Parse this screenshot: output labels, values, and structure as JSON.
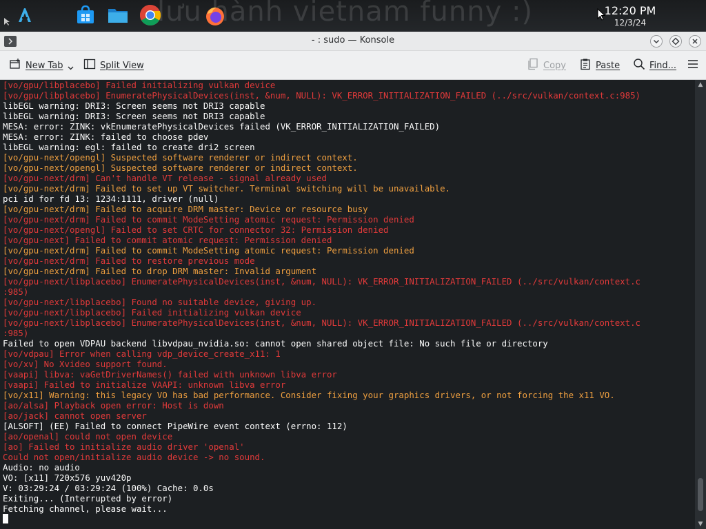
{
  "taskbar": {
    "wallpaper_text": "lưu hành vietnam funny :)",
    "time": "12:20 PM",
    "date": "12/3/24",
    "apps": [
      "app-launcher-icon",
      "discover-store-icon",
      "file-manager-icon",
      "chrome-icon",
      "firefox-icon"
    ]
  },
  "window": {
    "title": "- : sudo — Konsole"
  },
  "toolbar": {
    "new_tab": "New Tab",
    "split_view": "Split View",
    "copy": "Copy",
    "paste": "Paste",
    "find": "Find..."
  },
  "colors": {
    "terminal_bg": "#1c1f22",
    "text_white": "#fcfcfc",
    "text_red": "#e23a3a",
    "text_orange": "#f0a040"
  },
  "terminal": {
    "lines": [
      {
        "text": "[vo/gpu/libplacebo] Failed initializing vulkan device",
        "color": "red"
      },
      {
        "text": "[vo/gpu/libplacebo] EnumeratePhysicalDevices(inst, &num, NULL): VK_ERROR_INITIALIZATION_FAILED (../src/vulkan/context.c:985)",
        "color": "red"
      },
      {
        "text": "libEGL warning: DRI3: Screen seems not DRI3 capable",
        "color": "white"
      },
      {
        "text": "libEGL warning: DRI3: Screen seems not DRI3 capable",
        "color": "white"
      },
      {
        "text": "MESA: error: ZINK: vkEnumeratePhysicalDevices failed (VK_ERROR_INITIALIZATION_FAILED)",
        "color": "white"
      },
      {
        "text": "MESA: error: ZINK: failed to choose pdev",
        "color": "white"
      },
      {
        "text": "libEGL warning: egl: failed to create dri2 screen",
        "color": "white"
      },
      {
        "text": "[vo/gpu-next/opengl] Suspected software renderer or indirect context.",
        "color": "orange"
      },
      {
        "text": "[vo/gpu-next/opengl] Suspected software renderer or indirect context.",
        "color": "orange"
      },
      {
        "text": "[vo/gpu-next/drm] Can't handle VT release - signal already used",
        "color": "red"
      },
      {
        "text": "[vo/gpu-next/drm] Failed to set up VT switcher. Terminal switching will be unavailable.",
        "color": "orange"
      },
      {
        "text": "pci id for fd 13: 1234:1111, driver (null)",
        "color": "white"
      },
      {
        "text": "[vo/gpu-next/drm] Failed to acquire DRM master: Device or resource busy",
        "color": "orange"
      },
      {
        "text": "[vo/gpu-next/drm] Failed to commit ModeSetting atomic request: Permission denied",
        "color": "red"
      },
      {
        "text": "[vo/gpu-next/opengl] Failed to set CRTC for connector 32: Permission denied",
        "color": "red"
      },
      {
        "text": "[vo/gpu-next] Failed to commit atomic request: Permission denied",
        "color": "red"
      },
      {
        "text": "[vo/gpu-next/drm] Failed to commit ModeSetting atomic request: Permission denied",
        "color": "orange"
      },
      {
        "text": "[vo/gpu-next/drm] Failed to restore previous mode",
        "color": "red"
      },
      {
        "text": "[vo/gpu-next/drm] Failed to drop DRM master: Invalid argument",
        "color": "orange"
      },
      {
        "text": "[vo/gpu-next/libplacebo] EnumeratePhysicalDevices(inst, &num, NULL): VK_ERROR_INITIALIZATION_FAILED (../src/vulkan/context.c",
        "color": "red"
      },
      {
        "text": ":985)",
        "color": "red"
      },
      {
        "text": "[vo/gpu-next/libplacebo] Found no suitable device, giving up.",
        "color": "red"
      },
      {
        "text": "[vo/gpu-next/libplacebo] Failed initializing vulkan device",
        "color": "red"
      },
      {
        "text": "[vo/gpu-next/libplacebo] EnumeratePhysicalDevices(inst, &num, NULL): VK_ERROR_INITIALIZATION_FAILED (../src/vulkan/context.c",
        "color": "red"
      },
      {
        "text": ":985)",
        "color": "red"
      },
      {
        "text": "Failed to open VDPAU backend libvdpau_nvidia.so: cannot open shared object file: No such file or directory",
        "color": "white"
      },
      {
        "text": "[vo/vdpau] Error when calling vdp_device_create_x11: 1",
        "color": "red"
      },
      {
        "text": "[vo/xv] No Xvideo support found.",
        "color": "red"
      },
      {
        "text": "[vaapi] libva: vaGetDriverNames() failed with unknown libva error",
        "color": "red"
      },
      {
        "text": "[vaapi] Failed to initialize VAAPI: unknown libva error",
        "color": "red"
      },
      {
        "text": "[vo/x11] Warning: this legacy VO has bad performance. Consider fixing your graphics drivers, or not forcing the x11 VO.",
        "color": "orange"
      },
      {
        "text": "[ao/alsa] Playback open error: Host is down",
        "color": "red"
      },
      {
        "text": "[ao/jack] cannot open server",
        "color": "red"
      },
      {
        "text": "[ALSOFT] (EE) Failed to connect PipeWire event context (errno: 112)",
        "color": "white"
      },
      {
        "text": "[ao/openal] could not open device",
        "color": "red"
      },
      {
        "text": "[ao] Failed to initialize audio driver 'openal'",
        "color": "red"
      },
      {
        "text": "Could not open/initialize audio device -> no sound.",
        "color": "red"
      },
      {
        "text": "Audio: no audio",
        "color": "white"
      },
      {
        "text": "VO: [x11] 720x576 yuv420p",
        "color": "white"
      },
      {
        "text": "V: 03:29:24 / 03:29:24 (100%) Cache: 0.0s",
        "color": "white"
      },
      {
        "text": "Exiting... (Interrupted by error)",
        "color": "white"
      },
      {
        "text": "Fetching channel, please wait...",
        "color": "white"
      }
    ]
  }
}
